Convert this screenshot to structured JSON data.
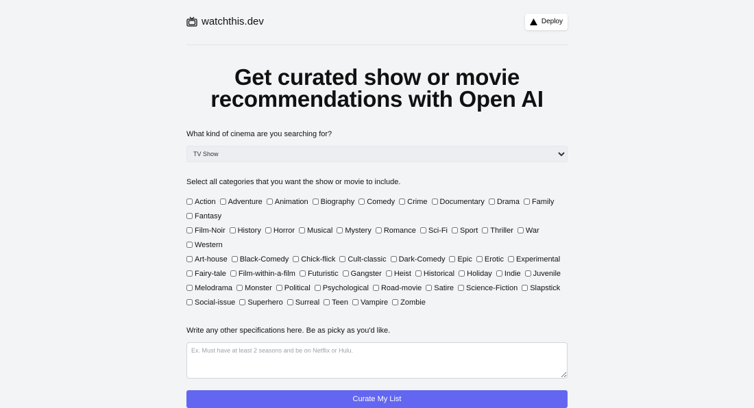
{
  "header": {
    "site_name": "watchthis.dev",
    "logo_icon": "tv-icon",
    "deploy_label": "Deploy",
    "deploy_icon": "triangle-icon"
  },
  "title": "Get curated show or movie recommendations with Open AI",
  "cinema": {
    "label": "What kind of cinema are you searching for?",
    "selected": "TV Show"
  },
  "categories": {
    "label": "Select all categories that you want the show or movie to include.",
    "items": [
      "Action",
      "Adventure",
      "Animation",
      "Biography",
      "Comedy",
      "Crime",
      "Documentary",
      "Drama",
      "Family",
      "Fantasy",
      "Film-Noir",
      "History",
      "Horror",
      "Musical",
      "Mystery",
      "Romance",
      "Sci-Fi",
      "Sport",
      "Thriller",
      "War",
      "Western",
      "Art-house",
      "Black-Comedy",
      "Chick-flick",
      "Cult-classic",
      "Dark-Comedy",
      "Epic",
      "Erotic",
      "Experimental",
      "Fairy-tale",
      "Film-within-a-film",
      "Futuristic",
      "Gangster",
      "Heist",
      "Historical",
      "Holiday",
      "Indie",
      "Juvenile",
      "Melodrama",
      "Monster",
      "Political",
      "Psychological",
      "Road-movie",
      "Satire",
      "Science-Fiction",
      "Slapstick",
      "Social-issue",
      "Superhero",
      "Surreal",
      "Teen",
      "Vampire",
      "Zombie"
    ]
  },
  "specs": {
    "label": "Write any other specifications here. Be as picky as you'd like.",
    "placeholder": "Ex. Must have at least 2 seasons and be on Netflix or Hulu.",
    "value": ""
  },
  "submit_label": "Curate My List",
  "colors": {
    "accent": "#6366f1",
    "background": "#f3f4f6"
  }
}
